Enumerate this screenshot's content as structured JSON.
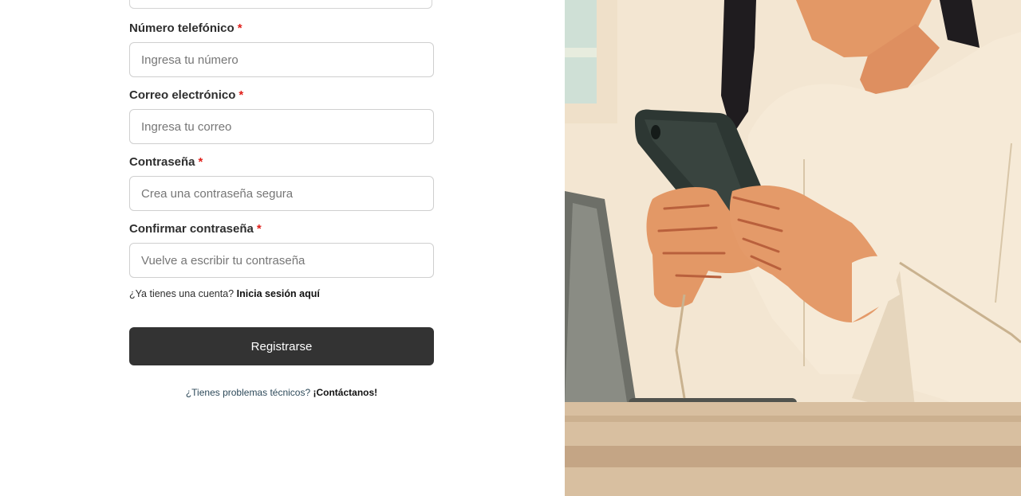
{
  "form": {
    "fields": [
      {
        "label": "Número telefónico",
        "required_mark": "*",
        "placeholder": "Ingresa tu número",
        "value": ""
      },
      {
        "label": "Correo electrónico",
        "required_mark": "*",
        "placeholder": "Ingresa tu correo",
        "value": ""
      },
      {
        "label": "Contraseña",
        "required_mark": "*",
        "placeholder": "Crea una contraseña segura",
        "value": ""
      },
      {
        "label": "Confirmar contraseña",
        "required_mark": "*",
        "placeholder": "Vuelve a escribir tu contraseña",
        "value": ""
      }
    ],
    "login_prompt": "¿Ya tienes una cuenta?",
    "login_link": "Inicia sesión aquí",
    "submit_label": "Registrarse",
    "help_prompt": "¿Tienes problemas técnicos?",
    "help_link": "¡Contáctanos!"
  },
  "colors": {
    "accent_button": "#333333",
    "required": "#e0201b",
    "illustration_background": "#f3e6d2"
  },
  "illustration": {
    "subject": "woman holding a smartphone next to a laptop"
  }
}
